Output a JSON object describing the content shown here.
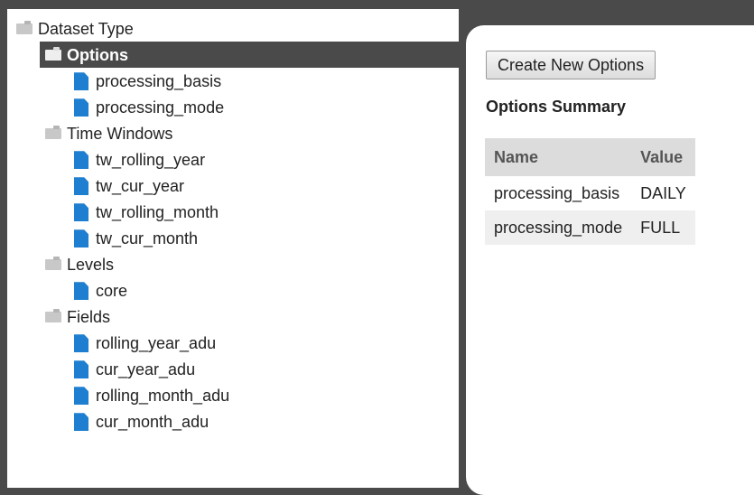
{
  "tree": {
    "root": {
      "label": "Dataset Type"
    },
    "folders": [
      {
        "label": "Options",
        "selected": true,
        "items": [
          "processing_basis",
          "processing_mode"
        ]
      },
      {
        "label": "Time Windows",
        "selected": false,
        "items": [
          "tw_rolling_year",
          "tw_cur_year",
          "tw_rolling_month",
          "tw_cur_month"
        ]
      },
      {
        "label": "Levels",
        "selected": false,
        "items": [
          "core"
        ]
      },
      {
        "label": "Fields",
        "selected": false,
        "items": [
          "rolling_year_adu",
          "cur_year_adu",
          "rolling_month_adu",
          "cur_month_adu"
        ]
      }
    ]
  },
  "detail": {
    "create_button": "Create New Options",
    "summary_title": "Options Summary",
    "table": {
      "headers": [
        "Name",
        "Value"
      ],
      "rows": [
        [
          "processing_basis",
          "DAILY"
        ],
        [
          "processing_mode",
          "FULL"
        ]
      ]
    }
  },
  "icons": {
    "folder": "folder-icon",
    "file": "file-icon"
  },
  "colors": {
    "selected_bg": "#4a4a4a",
    "file_icon": "#1e7fd0",
    "frame": "#4a4a4a"
  }
}
